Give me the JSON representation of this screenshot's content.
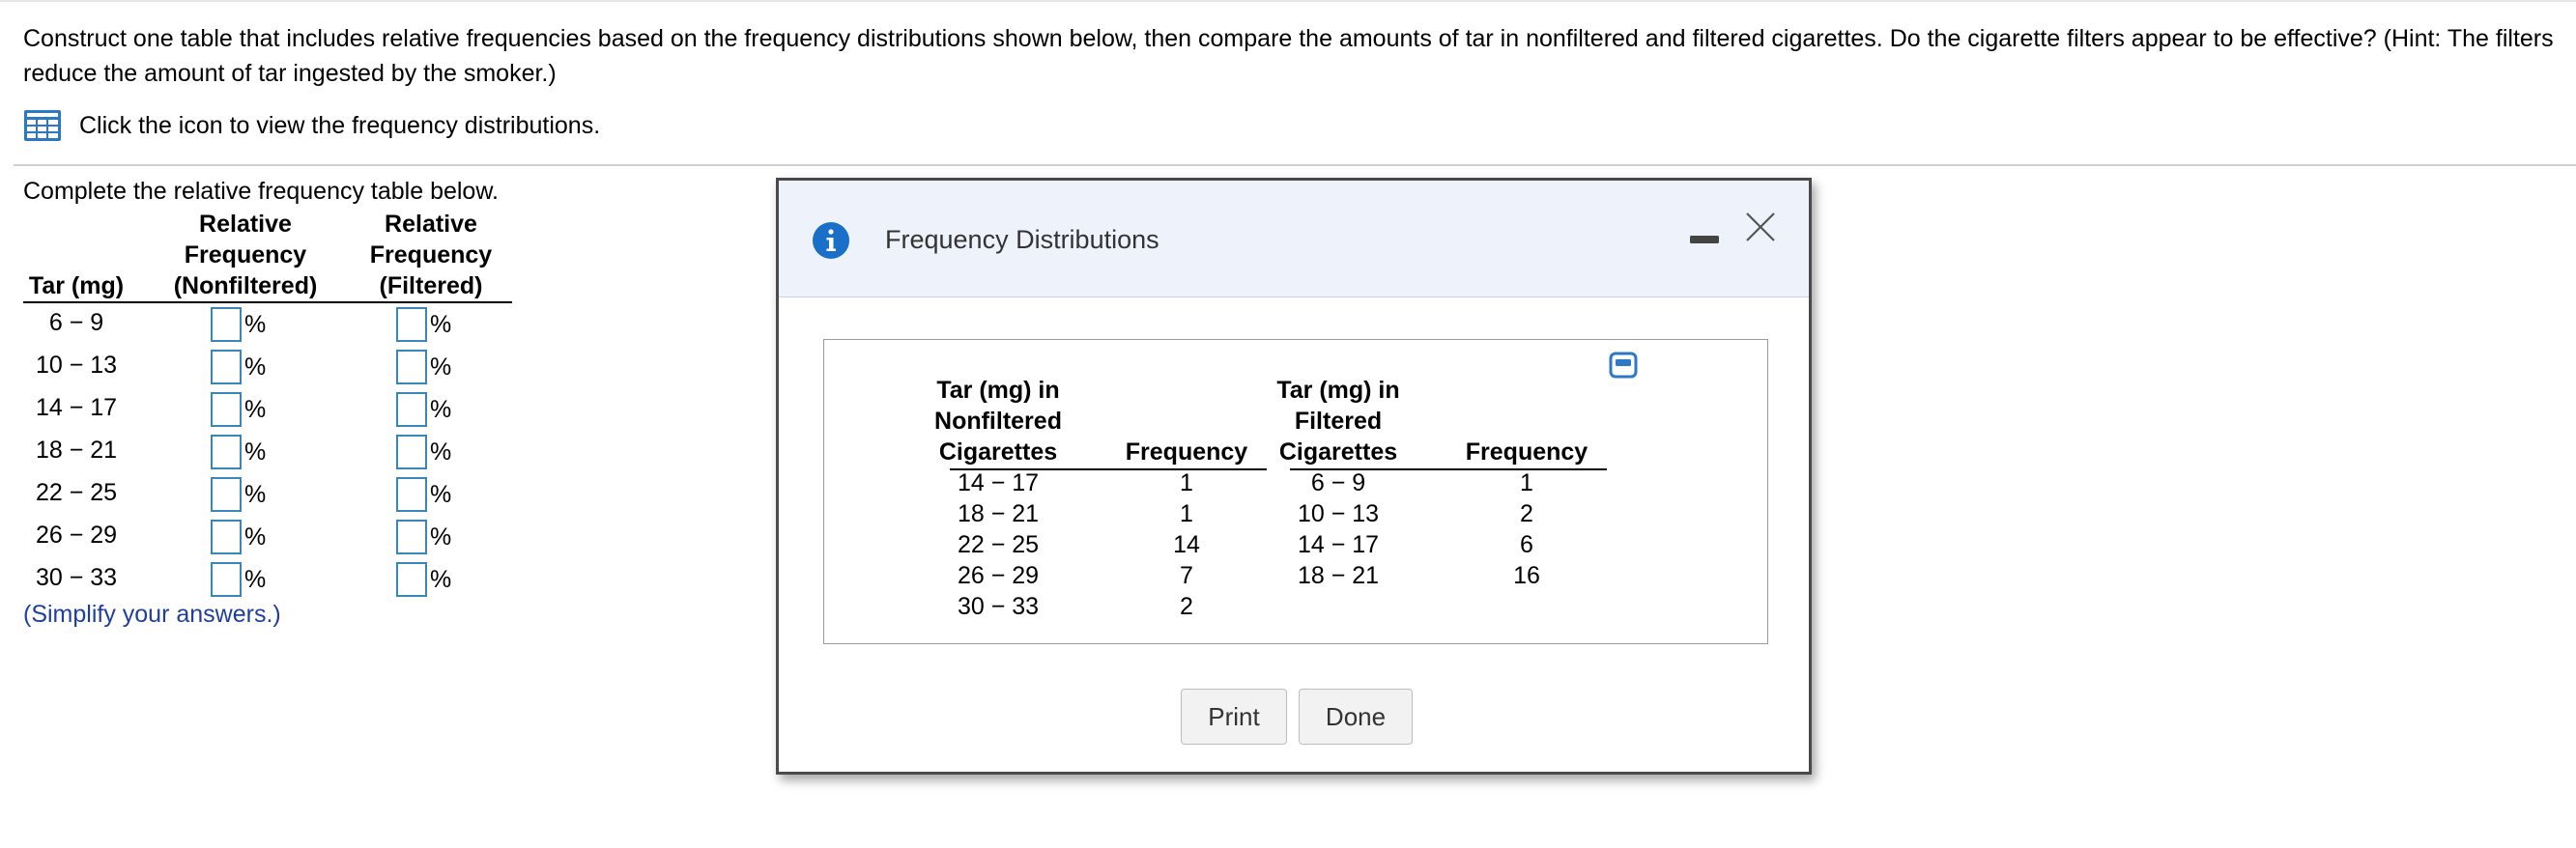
{
  "question": {
    "text": "Construct one table that includes relative frequencies based on the frequency distributions shown below, then compare the amounts of tar in nonfiltered and filtered cigarettes. Do the cigarette filters appear to be effective? (Hint: The filters reduce the amount of tar ingested by the smoker.)"
  },
  "hint": {
    "text": "Click the icon to view the frequency distributions.",
    "icon": "table-grid-icon"
  },
  "relative_table": {
    "instruction": "Complete the relative frequency table below.",
    "headers": {
      "tar": [
        "Tar (mg)"
      ],
      "nonfiltered": [
        "Relative",
        "Frequency",
        "(Nonfiltered)"
      ],
      "filtered": [
        "Relative",
        "Frequency",
        "(Filtered)"
      ]
    },
    "rows": [
      {
        "tar": "6 − 9",
        "unit_non": "%",
        "unit_fil": "%"
      },
      {
        "tar": "10 − 13",
        "unit_non": "%",
        "unit_fil": "%"
      },
      {
        "tar": "14 − 17",
        "unit_non": "%",
        "unit_fil": "%"
      },
      {
        "tar": "18 − 21",
        "unit_non": "%",
        "unit_fil": "%"
      },
      {
        "tar": "22 − 25",
        "unit_non": "%",
        "unit_fil": "%"
      },
      {
        "tar": "26 − 29",
        "unit_non": "%",
        "unit_fil": "%"
      },
      {
        "tar": "30 − 33",
        "unit_non": "%",
        "unit_fil": "%"
      }
    ],
    "note": "(Simplify your answers.)"
  },
  "dialog": {
    "title": "Frequency Distributions",
    "colors": {
      "header_bg": "#eef3fb",
      "info": "#1a6fc9",
      "input_border": "#3a86b8",
      "note": "#1f3fa0"
    },
    "table": {
      "nonfiltered": {
        "tar_header": [
          "Tar (mg) in",
          "Nonfiltered",
          "Cigarettes"
        ],
        "freq_header": "Frequency",
        "tar": [
          "14 − 17",
          "18 − 21",
          "22 − 25",
          "26 − 29",
          "30 − 33"
        ],
        "freq": [
          "1",
          "1",
          "14",
          "7",
          "2"
        ]
      },
      "filtered": {
        "tar_header": [
          "Tar (mg) in",
          "Filtered",
          "Cigarettes"
        ],
        "freq_header": "Frequency",
        "tar": [
          "6 − 9",
          "10 − 13",
          "14 − 17",
          "18 − 21"
        ],
        "freq": [
          "1",
          "2",
          "6",
          "16"
        ]
      }
    },
    "buttons": {
      "print": "Print",
      "done": "Done"
    }
  }
}
